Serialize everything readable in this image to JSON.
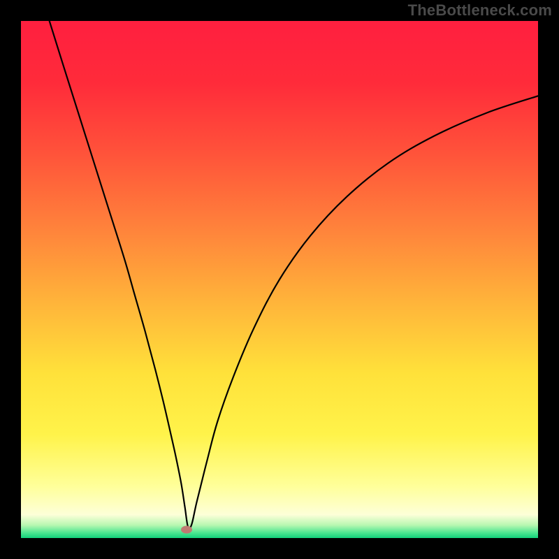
{
  "watermark": "TheBottleneck.com",
  "chart_data": {
    "type": "line",
    "title": "",
    "xlabel": "",
    "ylabel": "",
    "xlim": [
      0,
      100
    ],
    "ylim": [
      0,
      100
    ],
    "grid": false,
    "background_gradient": {
      "stops": [
        {
          "offset": 0.0,
          "color": "#ff1f3f"
        },
        {
          "offset": 0.12,
          "color": "#ff2b3a"
        },
        {
          "offset": 0.25,
          "color": "#ff513a"
        },
        {
          "offset": 0.4,
          "color": "#ff823b"
        },
        {
          "offset": 0.55,
          "color": "#ffb63a"
        },
        {
          "offset": 0.68,
          "color": "#ffe13a"
        },
        {
          "offset": 0.8,
          "color": "#fff34a"
        },
        {
          "offset": 0.9,
          "color": "#ffff9a"
        },
        {
          "offset": 0.955,
          "color": "#fdffd8"
        },
        {
          "offset": 0.975,
          "color": "#b8f7b1"
        },
        {
          "offset": 0.99,
          "color": "#4be690"
        },
        {
          "offset": 1.0,
          "color": "#12d07a"
        }
      ]
    },
    "series": [
      {
        "name": "bottleneck-curve",
        "color": "#000000",
        "x": [
          5.5,
          8,
          11,
          14,
          17,
          20,
          22,
          24,
          26,
          27.5,
          29,
          30,
          31,
          31.7,
          32.3,
          33,
          34,
          36,
          38,
          41,
          45,
          50,
          56,
          63,
          71,
          80,
          90,
          100
        ],
        "y": [
          100,
          92,
          82.5,
          73,
          63.5,
          54,
          47,
          40,
          32.5,
          26.5,
          20,
          15.5,
          10.5,
          6,
          2.2,
          2.6,
          7,
          15,
          22.5,
          31,
          40.5,
          50,
          58.5,
          66,
          72.5,
          77.8,
          82.2,
          85.5
        ]
      }
    ],
    "marker": {
      "x": 32.0,
      "y": 1.6,
      "color": "#bf7b72"
    }
  }
}
